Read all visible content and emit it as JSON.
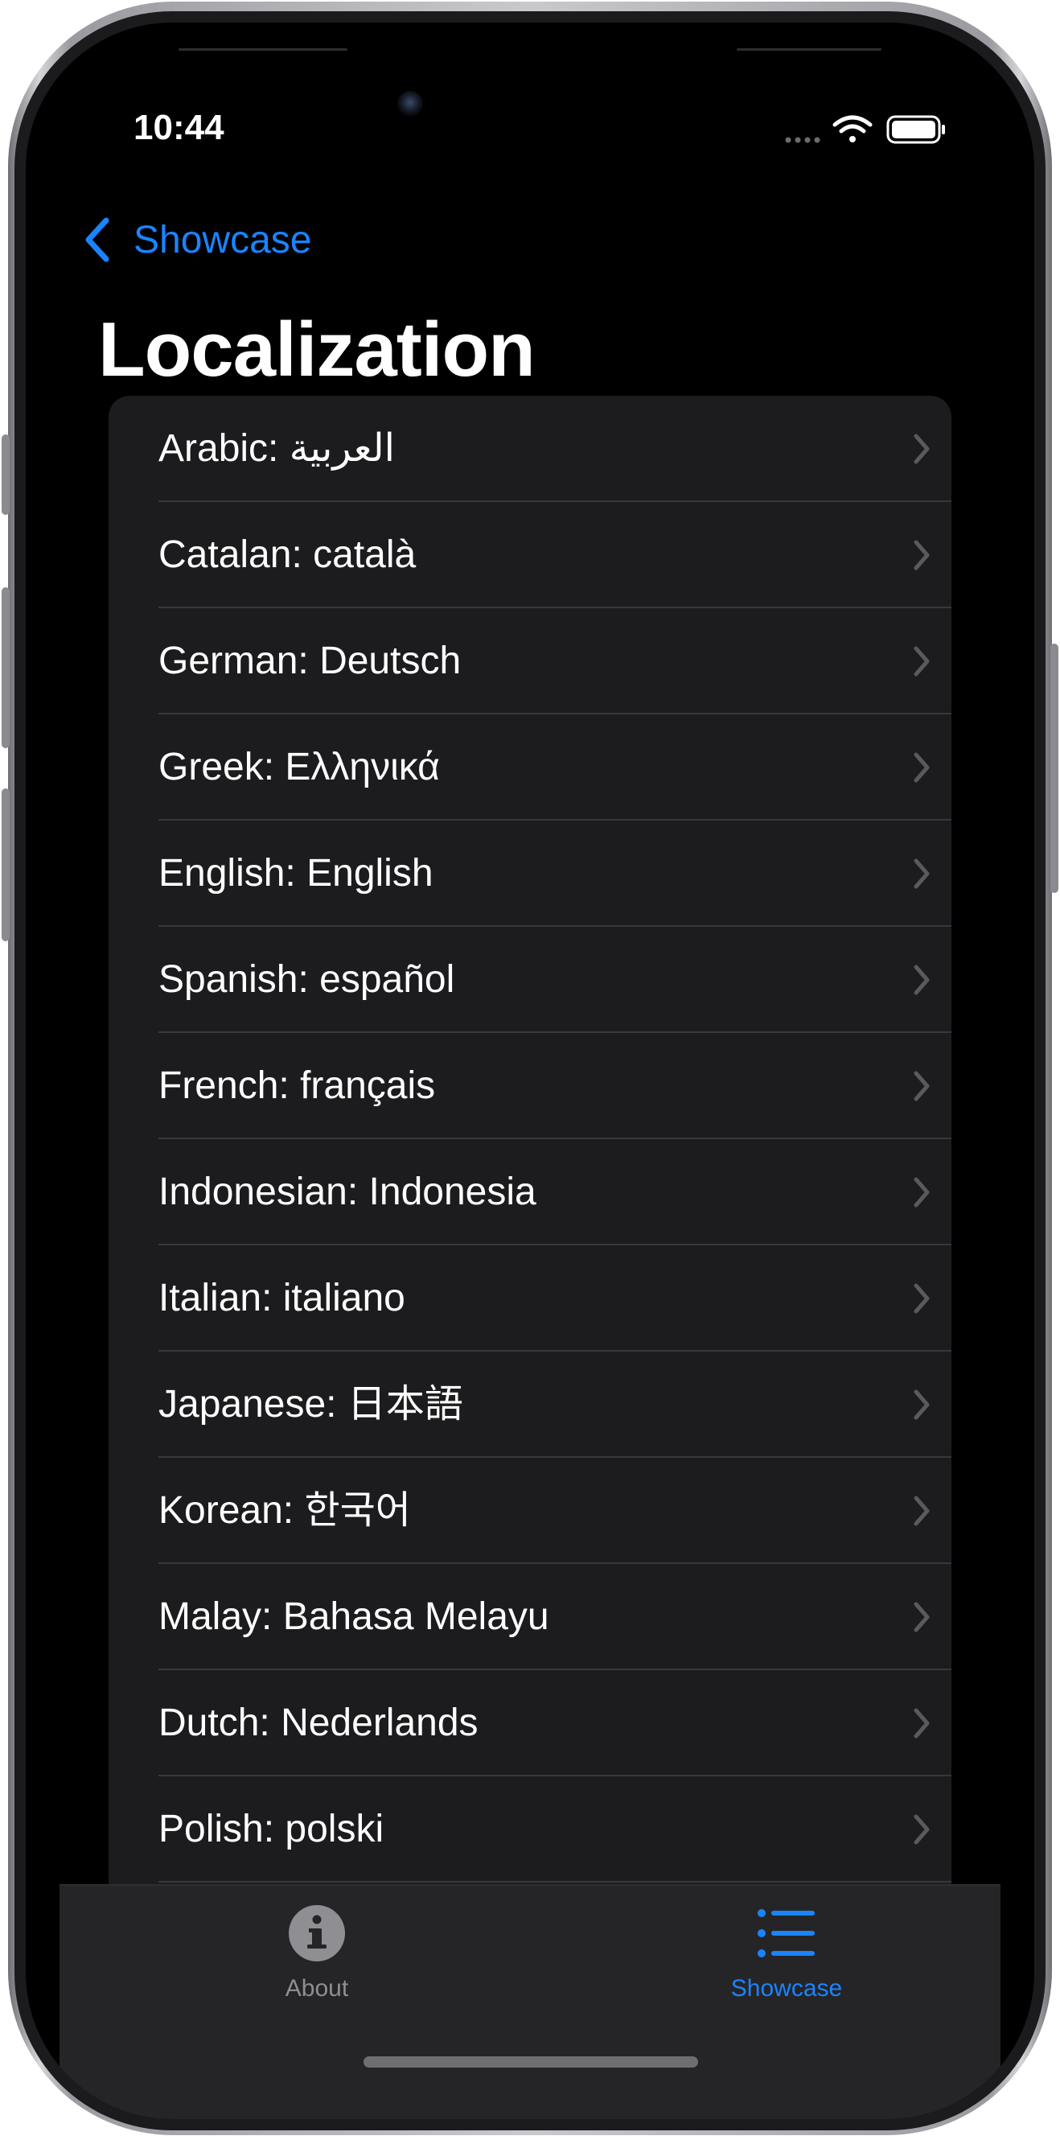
{
  "status_bar": {
    "time": "10:44",
    "icons": [
      "cellular-signal-icon",
      "wifi-icon",
      "battery-icon"
    ]
  },
  "nav": {
    "back_label": "Showcase",
    "title": "Localization"
  },
  "languages": [
    {
      "label": "Arabic: العربية"
    },
    {
      "label": "Catalan: català"
    },
    {
      "label": "German: Deutsch"
    },
    {
      "label": "Greek: Ελληνικά"
    },
    {
      "label": "English: English"
    },
    {
      "label": "Spanish: español"
    },
    {
      "label": "French: français"
    },
    {
      "label": "Indonesian: Indonesia"
    },
    {
      "label": "Italian: italiano"
    },
    {
      "label": "Japanese: 日本語"
    },
    {
      "label": "Korean: 한국어"
    },
    {
      "label": "Malay: Bahasa Melayu"
    },
    {
      "label": "Dutch: Nederlands"
    },
    {
      "label": "Polish: polski"
    }
  ],
  "tab_bar": {
    "tabs": [
      {
        "label": "About",
        "icon": "info-circle-icon",
        "selected": false
      },
      {
        "label": "Showcase",
        "icon": "list-icon",
        "selected": true
      }
    ]
  },
  "colors": {
    "accent": "#1a84ff",
    "background": "#000000",
    "list_background": "#1c1c1e",
    "tab_inactive": "#8e8e93"
  }
}
